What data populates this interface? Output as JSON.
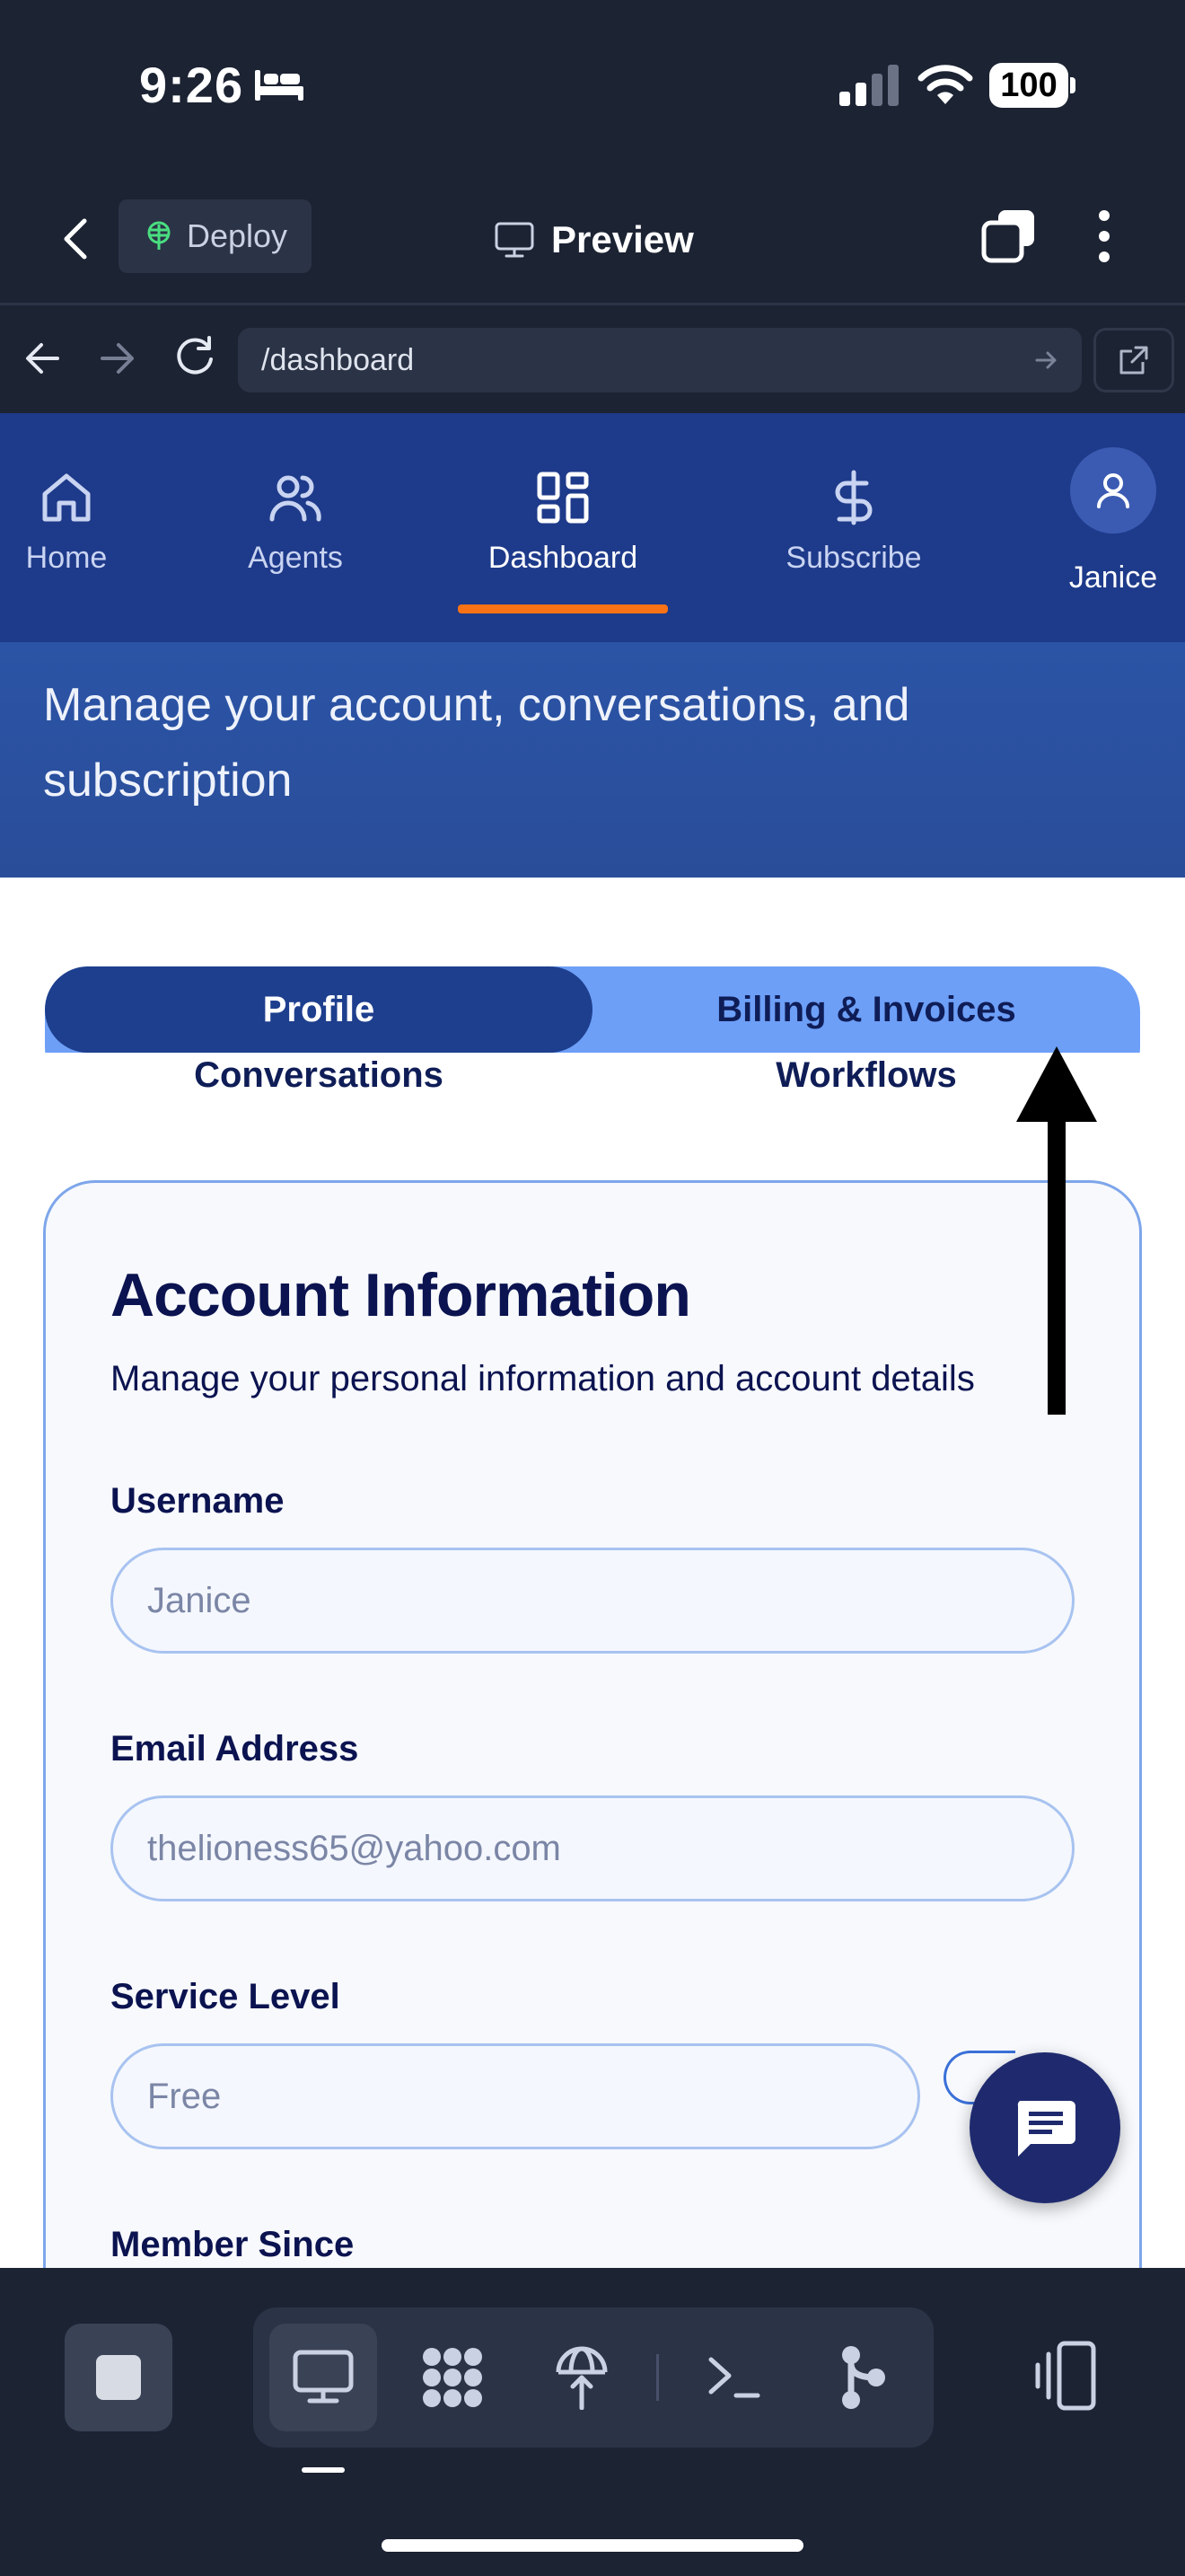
{
  "status_bar": {
    "time": "9:26",
    "battery": "100"
  },
  "app_bar": {
    "deploy_label": "Deploy",
    "preview_label": "Preview"
  },
  "browser": {
    "url": "/dashboard"
  },
  "site_nav": {
    "items": [
      {
        "label": "Home",
        "icon": "home-icon"
      },
      {
        "label": "Agents",
        "icon": "users-icon"
      },
      {
        "label": "Dashboard",
        "icon": "grid-icon",
        "active": true
      },
      {
        "label": "Subscribe",
        "icon": "dollar-icon"
      }
    ],
    "user": {
      "name": "Janice",
      "icon": "user-icon"
    },
    "active_color": "#f97316"
  },
  "hero": {
    "text": "Manage your account, conversations, and subscription"
  },
  "tabs": {
    "profile": "Profile",
    "billing": "Billing & Invoices",
    "conversations": "Conversations",
    "workflows": "Workflows",
    "selected": "Profile"
  },
  "account": {
    "title": "Account Information",
    "subtitle": "Manage your personal information and account details",
    "username_label": "Username",
    "username_value": "Janice",
    "email_label": "Email Address",
    "email_value": "thelioness65@yahoo.com",
    "service_label": "Service Level",
    "service_value": "Free",
    "member_label": "Member Since"
  },
  "colors": {
    "nav_bg": "#1e3a8a",
    "tab_active": "#1e3f8e",
    "tab_bg": "#6d9ff7",
    "text_dark": "#0b1350"
  }
}
